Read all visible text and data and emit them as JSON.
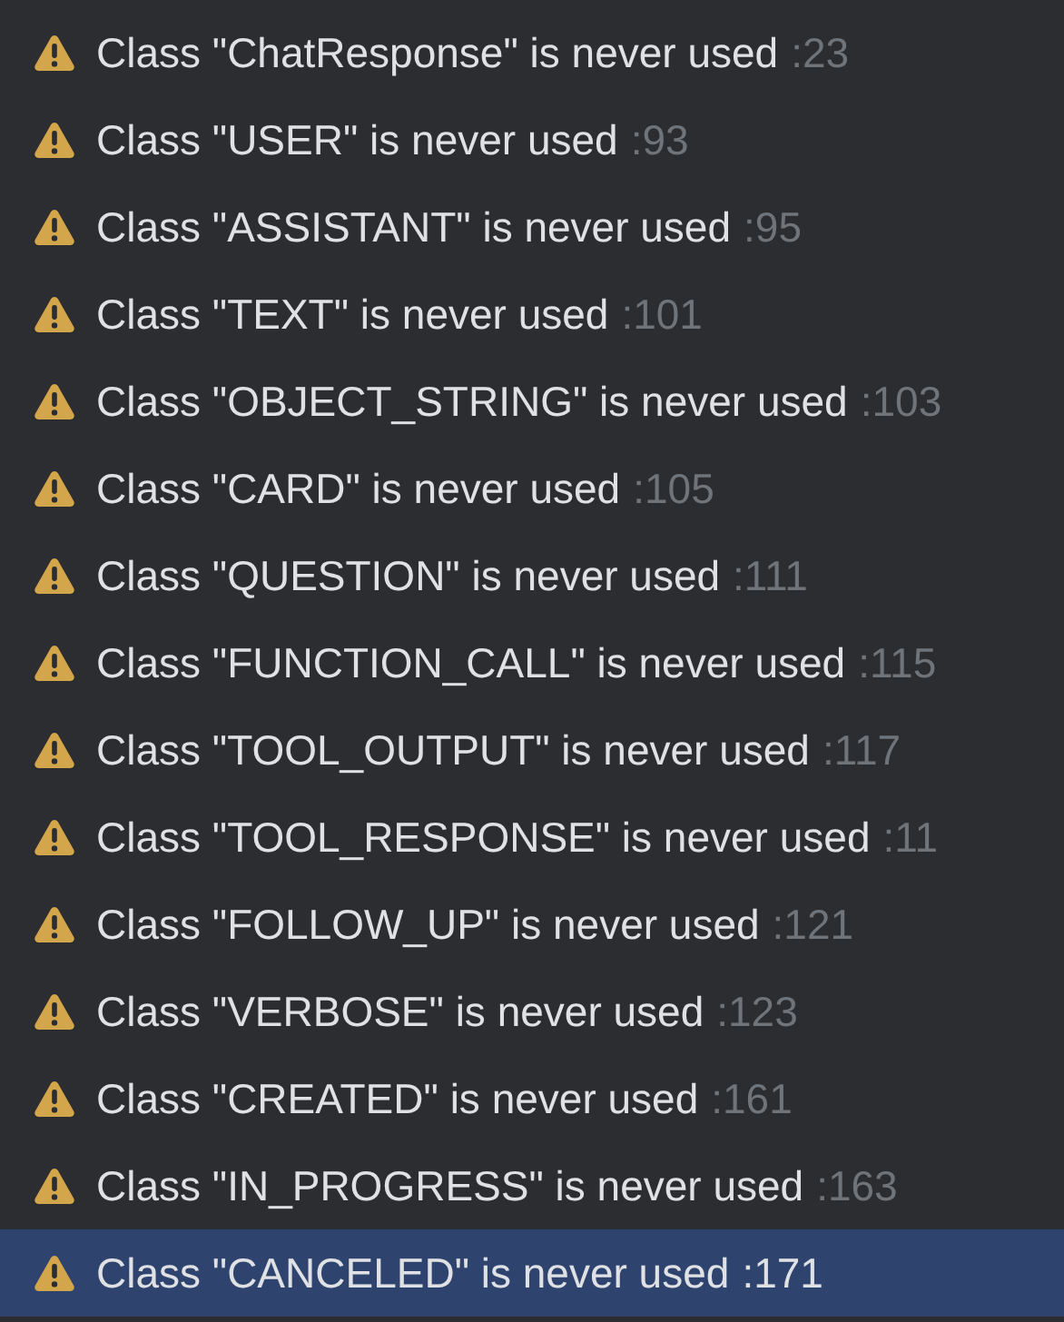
{
  "problems": [
    {
      "message": "Class \"ChatResponse\" is never used",
      "line": ":23",
      "selected": false
    },
    {
      "message": "Class \"USER\" is never used",
      "line": ":93",
      "selected": false
    },
    {
      "message": "Class \"ASSISTANT\" is never used",
      "line": ":95",
      "selected": false
    },
    {
      "message": "Class \"TEXT\" is never used",
      "line": ":101",
      "selected": false
    },
    {
      "message": "Class \"OBJECT_STRING\" is never used",
      "line": ":103",
      "selected": false
    },
    {
      "message": "Class \"CARD\" is never used",
      "line": ":105",
      "selected": false
    },
    {
      "message": "Class \"QUESTION\" is never used",
      "line": ":111",
      "selected": false
    },
    {
      "message": "Class \"FUNCTION_CALL\" is never used",
      "line": ":115",
      "selected": false
    },
    {
      "message": "Class \"TOOL_OUTPUT\" is never used",
      "line": ":117",
      "selected": false
    },
    {
      "message": "Class \"TOOL_RESPONSE\" is never used",
      "line": ":11",
      "selected": false
    },
    {
      "message": "Class \"FOLLOW_UP\" is never used",
      "line": ":121",
      "selected": false
    },
    {
      "message": "Class \"VERBOSE\" is never used",
      "line": ":123",
      "selected": false
    },
    {
      "message": "Class \"CREATED\" is never used",
      "line": ":161",
      "selected": false
    },
    {
      "message": "Class \"IN_PROGRESS\" is never used",
      "line": ":163",
      "selected": false
    },
    {
      "message": "Class \"CANCELED\" is never used",
      "line": ":171",
      "selected": true
    }
  ]
}
